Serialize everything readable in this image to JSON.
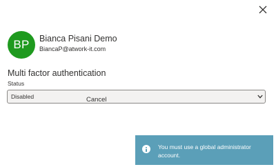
{
  "header": {
    "close_icon": "close-icon"
  },
  "user": {
    "initials": "BP",
    "display_name": "Bianca Pisani Demo",
    "email": "BiancaP@atwork-it.com",
    "avatar_color": "#1f9a1f"
  },
  "mfa": {
    "section_title": "Multi factor authentication",
    "status_label": "Status",
    "status_value": "Disabled"
  },
  "actions": {
    "cancel_label": "Cancel"
  },
  "notification": {
    "icon": "info-icon",
    "message": "You must use a global administrator account.",
    "background_color": "#5b9fb8"
  }
}
